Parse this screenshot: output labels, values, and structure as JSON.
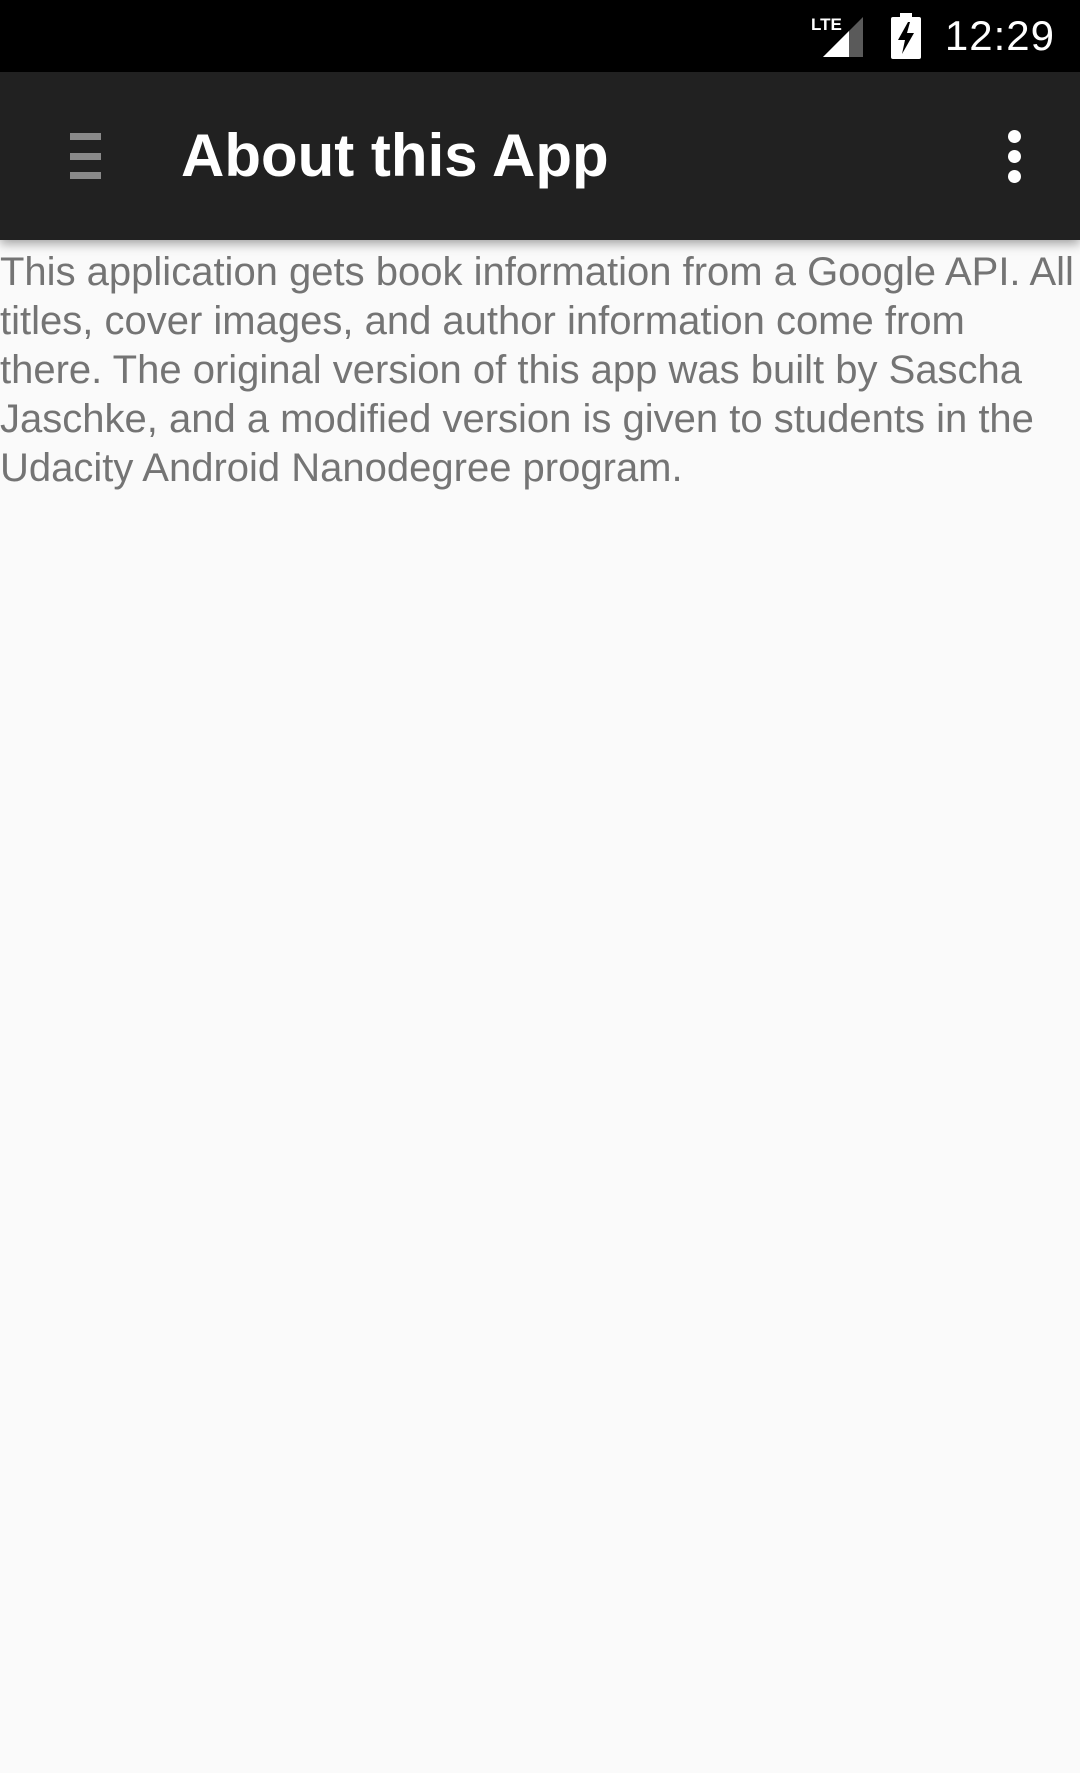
{
  "status_bar": {
    "network_label": "LTE",
    "time": "12:29",
    "icons": {
      "signal": "signal-icon",
      "battery": "battery-charging-icon"
    }
  },
  "app_bar": {
    "title": "About this App",
    "nav_icon": "menu-icon",
    "overflow_icon": "more-vert-icon"
  },
  "content": {
    "about_text": "This application gets book information from a Google API. All titles, cover images, and author information come from there. The original version of this app was built by Sascha Jaschke, and a modified version is given to students in the Udacity Android Nanodegree program."
  },
  "colors": {
    "status_bar": "#000000",
    "app_bar": "#212121",
    "background": "#fafafa",
    "body_text": "#747474"
  }
}
